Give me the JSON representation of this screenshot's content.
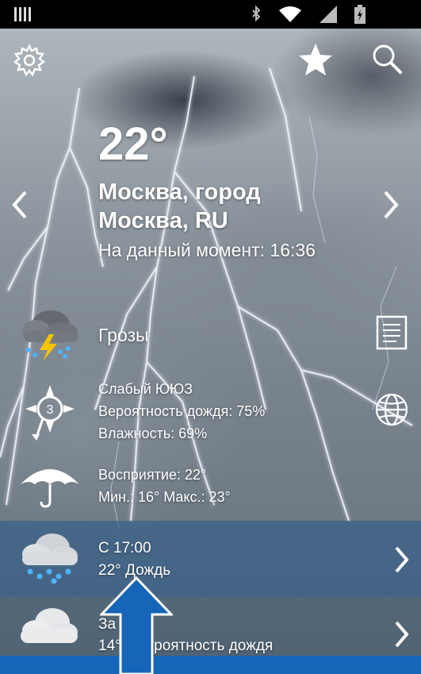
{
  "status_bar": {
    "icons": [
      "bars-icon",
      "bluetooth-icon",
      "wifi-icon",
      "signal-icon",
      "battery-icon"
    ]
  },
  "toolbar": {
    "icons": [
      "gear-icon",
      "star-icon",
      "search-icon"
    ]
  },
  "current": {
    "temperature": "22°",
    "city_line1": "Москва, город",
    "city_line2": "Москва, RU",
    "time_label": "На данный момент: 16:36",
    "condition": "Грозы",
    "wind_number": "3",
    "details_wind": [
      "Слабый ЮЮЗ",
      "Вероятность дождя: 75%",
      "Влажность: 69%"
    ],
    "details_feel": [
      "Восприятие: 22°",
      "Мин.: 16° Макс.: 23°"
    ]
  },
  "forecast": [
    {
      "time": "С 17:00",
      "desc": "22° Дождь"
    },
    {
      "time": "За",
      "desc": "14°  °  Вероятность дождя"
    }
  ],
  "colors": {
    "accent_blue": "#1565b8",
    "status_bar": "#000000"
  }
}
